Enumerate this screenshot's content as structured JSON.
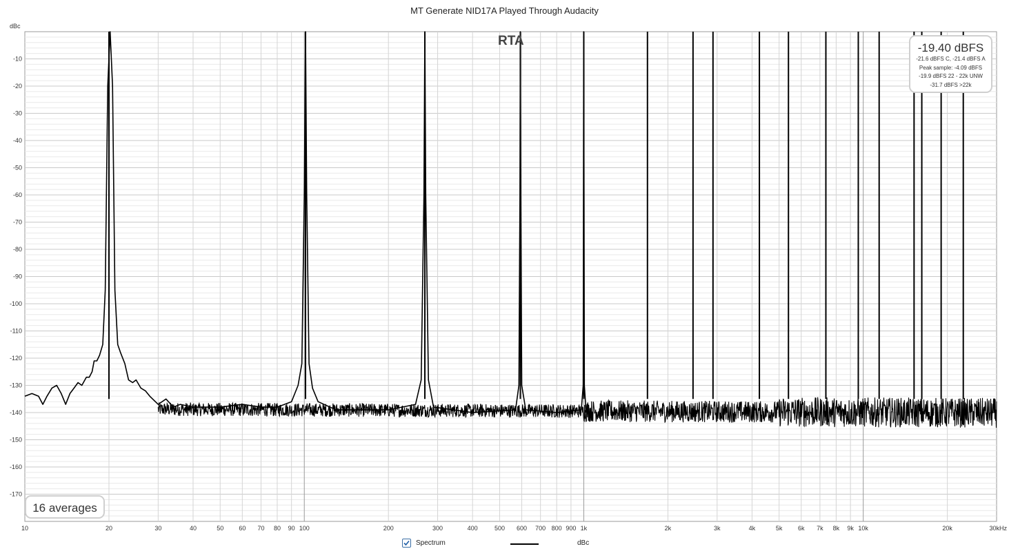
{
  "chart_data": {
    "type": "line",
    "title": "MT Generate NID17A Played Through Audacity",
    "ylabel": "dBc",
    "xlabel": "",
    "xscale": "log",
    "xlim": [
      10,
      30000
    ],
    "ylim": [
      -180,
      0
    ],
    "grid": true,
    "x_ticks": [
      {
        "v": 10,
        "label": "10"
      },
      {
        "v": 20,
        "label": "20"
      },
      {
        "v": 30,
        "label": "30"
      },
      {
        "v": 40,
        "label": "40"
      },
      {
        "v": 50,
        "label": "50"
      },
      {
        "v": 60,
        "label": "60"
      },
      {
        "v": 70,
        "label": "70"
      },
      {
        "v": 80,
        "label": "80"
      },
      {
        "v": 90,
        "label": "90"
      },
      {
        "v": 100,
        "label": "100"
      },
      {
        "v": 200,
        "label": "200"
      },
      {
        "v": 300,
        "label": "300"
      },
      {
        "v": 400,
        "label": "400"
      },
      {
        "v": 500,
        "label": "500"
      },
      {
        "v": 600,
        "label": "600"
      },
      {
        "v": 700,
        "label": "700"
      },
      {
        "v": 800,
        "label": "800"
      },
      {
        "v": 900,
        "label": "900"
      },
      {
        "v": 1000,
        "label": "1k"
      },
      {
        "v": 2000,
        "label": "2k"
      },
      {
        "v": 3000,
        "label": "3k"
      },
      {
        "v": 4000,
        "label": "4k"
      },
      {
        "v": 5000,
        "label": "5k"
      },
      {
        "v": 6000,
        "label": "6k"
      },
      {
        "v": 7000,
        "label": "7k"
      },
      {
        "v": 8000,
        "label": "8k"
      },
      {
        "v": 9000,
        "label": "9k"
      },
      {
        "v": 10000,
        "label": "10k"
      },
      {
        "v": 20000,
        "label": "20k"
      },
      {
        "v": 30000,
        "label": "30kHz"
      }
    ],
    "y_ticks": [
      {
        "v": -10,
        "label": "-10"
      },
      {
        "v": -20,
        "label": "-20"
      },
      {
        "v": -30,
        "label": "-30"
      },
      {
        "v": -40,
        "label": "-40"
      },
      {
        "v": -50,
        "label": "-50"
      },
      {
        "v": -60,
        "label": "-60"
      },
      {
        "v": -70,
        "label": "-70"
      },
      {
        "v": -80,
        "label": "-80"
      },
      {
        "v": -90,
        "label": "-90"
      },
      {
        "v": -100,
        "label": "-100"
      },
      {
        "v": -110,
        "label": "-110"
      },
      {
        "v": -120,
        "label": "-120"
      },
      {
        "v": -130,
        "label": "-130"
      },
      {
        "v": -140,
        "label": "-140"
      },
      {
        "v": -150,
        "label": "-150"
      },
      {
        "v": -160,
        "label": "-160"
      },
      {
        "v": -170,
        "label": "-170"
      }
    ],
    "series": [
      {
        "name": "Spectrum",
        "color": "#000000",
        "noise_floor_db": -139,
        "tones": [
          {
            "freq_hz": 20,
            "level_db": 0
          },
          {
            "freq_hz": 101,
            "level_db": 0
          },
          {
            "freq_hz": 270,
            "level_db": 0
          },
          {
            "freq_hz": 593,
            "level_db": 0
          },
          {
            "freq_hz": 1000,
            "level_db": 0
          },
          {
            "freq_hz": 1690,
            "level_db": 0
          },
          {
            "freq_hz": 2460,
            "level_db": 0
          },
          {
            "freq_hz": 2900,
            "level_db": 0
          },
          {
            "freq_hz": 4250,
            "level_db": 0
          },
          {
            "freq_hz": 5400,
            "level_db": 0
          },
          {
            "freq_hz": 7350,
            "level_db": 0
          },
          {
            "freq_hz": 9600,
            "level_db": 0
          },
          {
            "freq_hz": 11400,
            "level_db": 0
          },
          {
            "freq_hz": 15200,
            "level_db": 0
          },
          {
            "freq_hz": 16200,
            "level_db": 0
          },
          {
            "freq_hz": 19000,
            "level_db": 0
          },
          {
            "freq_hz": 22800,
            "level_db": 0
          }
        ],
        "low_freq_points": [
          [
            10,
            -134
          ],
          [
            10.6,
            -133
          ],
          [
            11.2,
            -134
          ],
          [
            11.6,
            -137
          ],
          [
            12,
            -134
          ],
          [
            12.5,
            -131
          ],
          [
            13,
            -130
          ],
          [
            13.5,
            -133
          ],
          [
            14,
            -137
          ],
          [
            14.5,
            -133
          ],
          [
            15,
            -131
          ],
          [
            15.5,
            -129
          ],
          [
            16,
            -130
          ],
          [
            16.6,
            -127
          ],
          [
            17,
            -127
          ],
          [
            17.4,
            -125
          ],
          [
            17.7,
            -121
          ],
          [
            18.1,
            -121
          ],
          [
            18.5,
            -119
          ],
          [
            19,
            -115
          ],
          [
            19.4,
            -95
          ],
          [
            19.8,
            -20
          ],
          [
            20.2,
            0
          ],
          [
            20.6,
            -20
          ],
          [
            21.0,
            -95
          ],
          [
            21.5,
            -115
          ],
          [
            22,
            -118
          ],
          [
            22.8,
            -122
          ],
          [
            23.5,
            -128
          ],
          [
            24.3,
            -129
          ],
          [
            25,
            -128
          ],
          [
            26,
            -131
          ],
          [
            27,
            -132
          ],
          [
            28,
            -134
          ],
          [
            30,
            -137
          ],
          [
            32,
            -135
          ],
          [
            34,
            -138
          ],
          [
            36,
            -137
          ],
          [
            40,
            -138
          ],
          [
            50,
            -138
          ],
          [
            60,
            -137
          ],
          [
            70,
            -138
          ],
          [
            80,
            -138
          ],
          [
            90,
            -136
          ],
          [
            95,
            -130
          ],
          [
            98,
            -122
          ],
          [
            100,
            -60
          ],
          [
            101,
            0
          ],
          [
            102,
            -60
          ],
          [
            104,
            -122
          ],
          [
            107,
            -131
          ],
          [
            112,
            -136
          ],
          [
            130,
            -139
          ],
          [
            200,
            -139
          ],
          [
            250,
            -137
          ],
          [
            262,
            -128
          ],
          [
            268,
            -60
          ],
          [
            270,
            0
          ],
          [
            272,
            -60
          ],
          [
            278,
            -128
          ],
          [
            290,
            -138
          ],
          [
            400,
            -140
          ],
          [
            570,
            -139
          ],
          [
            586,
            -130
          ],
          [
            591,
            -60
          ],
          [
            593,
            0
          ],
          [
            595,
            -60
          ],
          [
            600,
            -130
          ],
          [
            620,
            -139
          ],
          [
            800,
            -140
          ],
          [
            980,
            -139
          ],
          [
            995,
            -130
          ],
          [
            1000,
            0
          ],
          [
            1005,
            -130
          ],
          [
            1020,
            -140
          ]
        ]
      }
    ],
    "annotations": {
      "rta_label": "RTA",
      "level_main": "-19.40 dBFS",
      "level_lines": [
        "-21.6 dBFS C, -21.4 dBFS A",
        "Peak sample: -4.09 dBFS",
        "-19.9 dBFS 22 - 22k UNW",
        "-31.7 dBFS >22k"
      ],
      "averages": "16 averages"
    }
  },
  "legend": {
    "spectrum_label": "Spectrum",
    "spectrum_checked": true,
    "unit_label": "dBc"
  }
}
